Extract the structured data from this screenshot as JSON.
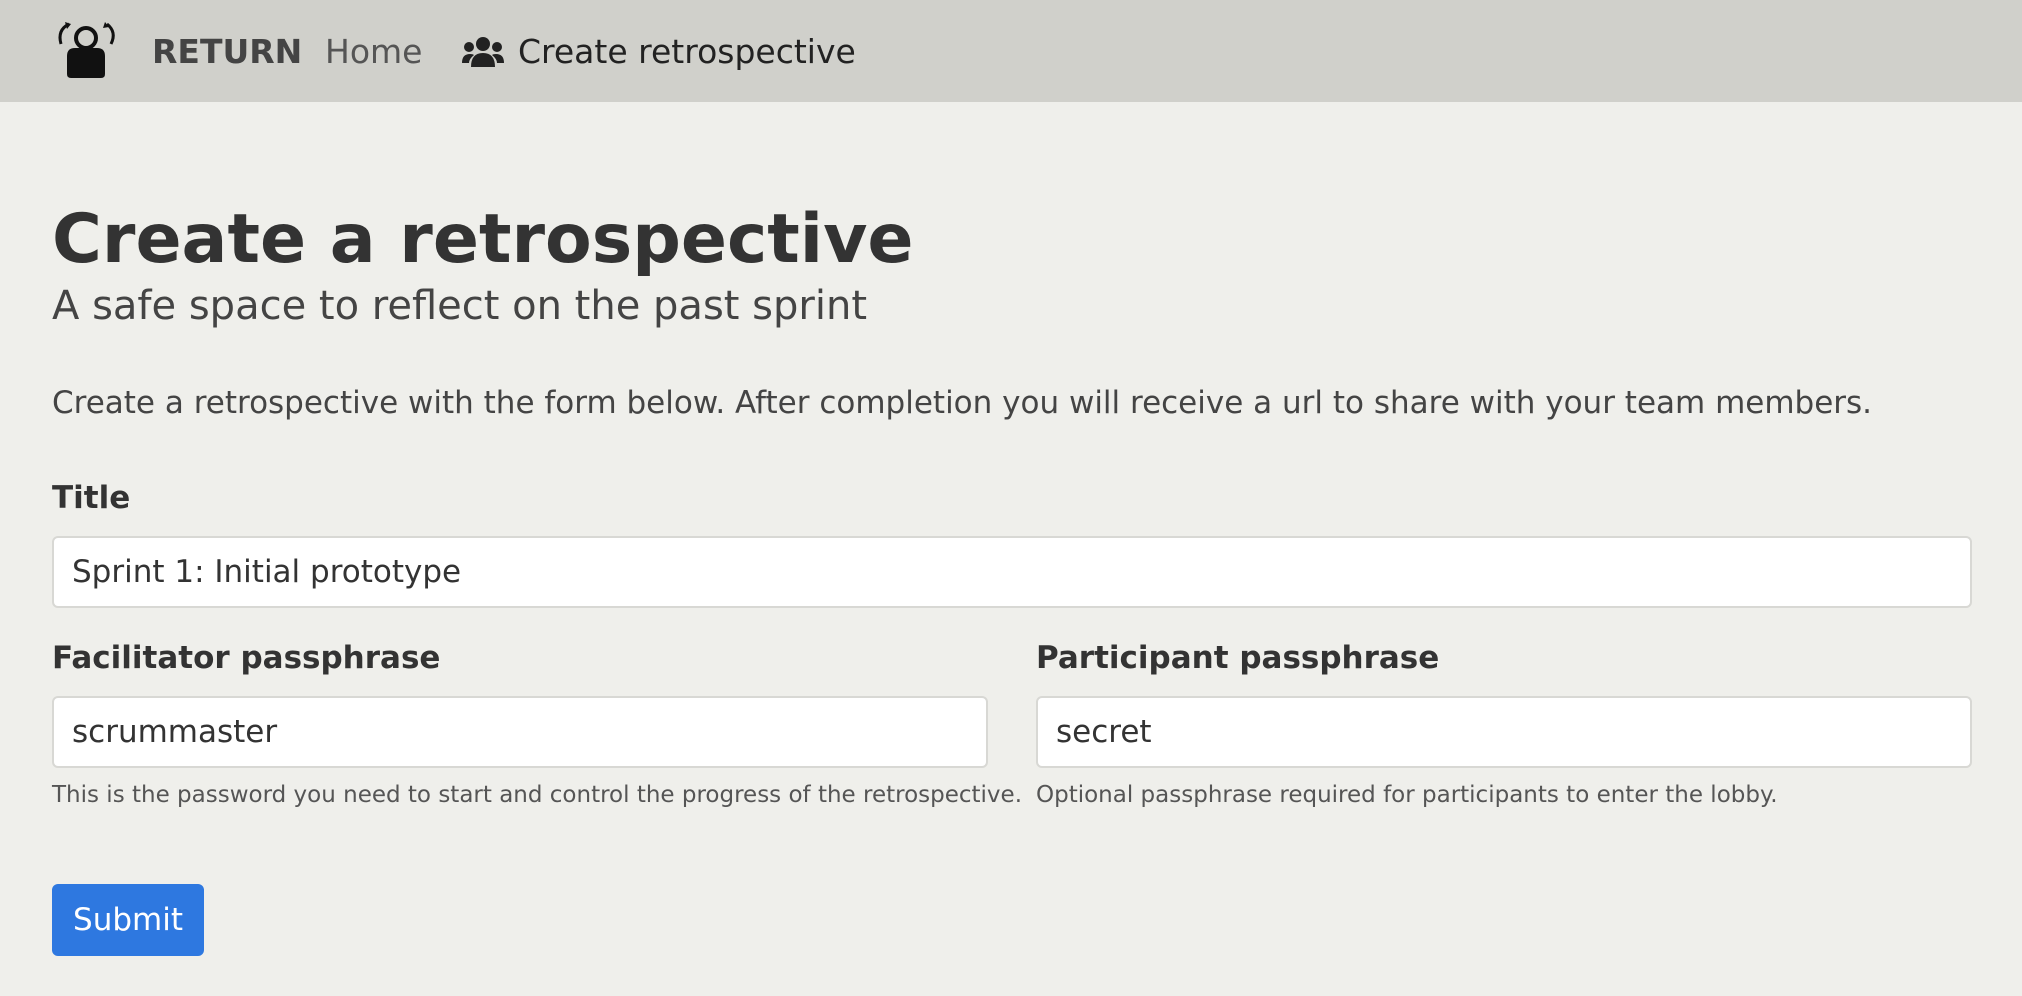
{
  "navbar": {
    "brand": "RETURN",
    "home_label": "Home",
    "create_label": "Create retrospective",
    "logo_icon": "return-logo-icon",
    "create_icon": "users-icon"
  },
  "page": {
    "title": "Create a retrospective",
    "subtitle": "A safe space to reflect on the past sprint",
    "lead": "Create a retrospective with the form below. After completion you will receive a url to share with your team members."
  },
  "form": {
    "title_label": "Title",
    "title_value": "Sprint 1: Initial prototype",
    "facilitator_label": "Facilitator passphrase",
    "facilitator_value": "scrummaster",
    "facilitator_help": "This is the password you need to start and control the progress of the retrospective.",
    "participant_label": "Participant passphrase",
    "participant_value": "secret",
    "participant_help": "Optional passphrase required for participants to enter the lobby.",
    "submit_label": "Submit"
  },
  "colors": {
    "navbar_bg": "#d0d0cb",
    "page_bg": "#efefeb",
    "primary": "#2e78e0"
  }
}
